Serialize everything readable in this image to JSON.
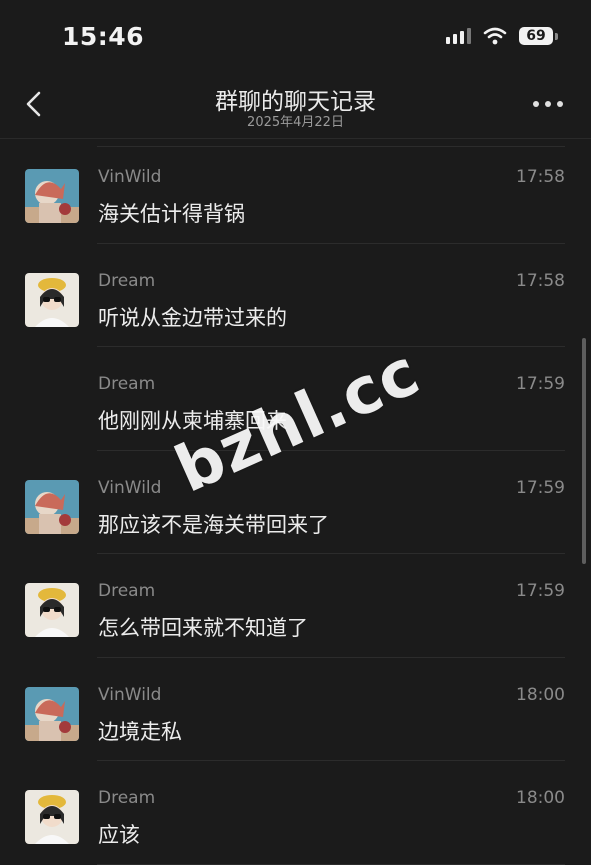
{
  "status_bar": {
    "time": "15:46",
    "battery": "69"
  },
  "nav": {
    "title": "群聊的聊天记录",
    "subtitle": "2025年4月22日"
  },
  "messages": [
    {
      "sender": "VinWild",
      "time": "17:58",
      "text": "海关估计得背锅",
      "avatar": "vinwild-avatar"
    },
    {
      "sender": "Dream",
      "time": "17:58",
      "text": "听说从金边带过来的",
      "avatar": "dream-avatar"
    },
    {
      "sender": "Dream",
      "time": "17:59",
      "text": "他刚刚从柬埔寨回来",
      "avatar": ""
    },
    {
      "sender": "VinWild",
      "time": "17:59",
      "text": "那应该不是海关带回来了",
      "avatar": "vinwild-avatar"
    },
    {
      "sender": "Dream",
      "time": "17:59",
      "text": "怎么带回来就不知道了",
      "avatar": "dream-avatar"
    },
    {
      "sender": "VinWild",
      "time": "18:00",
      "text": "边境走私",
      "avatar": "vinwild-avatar"
    },
    {
      "sender": "Dream",
      "time": "18:00",
      "text": "应该",
      "avatar": "dream-avatar"
    }
  ],
  "watermark": "bzhl.cc",
  "icons": [
    "back-icon",
    "more-icon",
    "signal-icon",
    "wifi-icon",
    "battery-icon"
  ]
}
